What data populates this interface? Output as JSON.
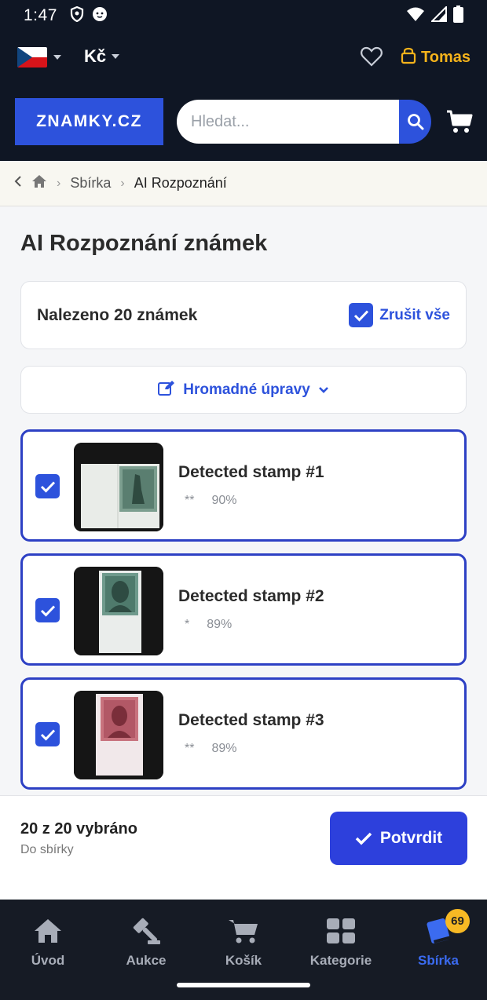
{
  "status_bar": {
    "time": "1:47"
  },
  "header": {
    "currency": "Kč",
    "user_name": "Tomas",
    "logo_text": "ZNAMKY.CZ",
    "search_placeholder": "Hledat..."
  },
  "breadcrumb": {
    "items": [
      "Sbírka",
      "AI Rozpoznání"
    ]
  },
  "page_title": "AI Rozpoznání známek",
  "found": {
    "text": "Nalezeno 20 známek",
    "unselect_label": "Zrušit vše"
  },
  "bulk_edit_label": "Hromadné úpravy",
  "stamps": [
    {
      "name": "Detected stamp #1",
      "grade": "**",
      "confidence": "90%",
      "checked": true
    },
    {
      "name": "Detected stamp #2",
      "grade": "*",
      "confidence": "89%",
      "checked": true
    },
    {
      "name": "Detected stamp #3",
      "grade": "**",
      "confidence": "89%",
      "checked": true
    }
  ],
  "action_bar": {
    "count_text": "20 z 20 vybráno",
    "sub_text": "Do sbírky",
    "confirm_label": "Potvrdit"
  },
  "bottom_nav": {
    "items": [
      {
        "label": "Úvod",
        "icon": "home-icon"
      },
      {
        "label": "Aukce",
        "icon": "gavel-icon"
      },
      {
        "label": "Košík",
        "icon": "cart-icon"
      },
      {
        "label": "Kategorie",
        "icon": "grid-icon"
      },
      {
        "label": "Sbírka",
        "icon": "album-icon",
        "badge": "69",
        "active": true
      }
    ]
  },
  "colors": {
    "accent": "#2d52dc",
    "header_bg": "#0f1624",
    "user_gold": "#f5b31b",
    "badge": "#f7b924"
  }
}
